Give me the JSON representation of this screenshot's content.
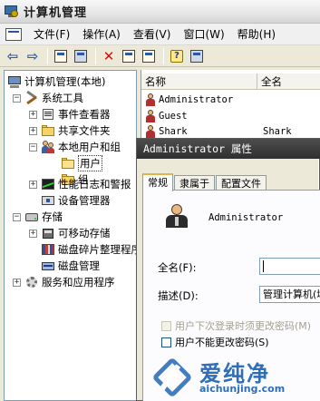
{
  "window": {
    "title": "计算机管理"
  },
  "menu": {
    "items": [
      "文件(F)",
      "操作(A)",
      "查看(V)",
      "窗口(W)",
      "帮助(H)"
    ]
  },
  "tree": {
    "root": "计算机管理(本地)",
    "system_tools": "系统工具",
    "event_viewer": "事件查看器",
    "shared_folders": "共享文件夹",
    "local_users_groups": "本地用户和组",
    "users": "用户",
    "groups": "组",
    "perf_logs": "性能日志和警报",
    "device_manager": "设备管理器",
    "storage": "存储",
    "removable_storage": "可移动存储",
    "disk_defrag": "磁盘碎片整理程序",
    "disk_management": "磁盘管理",
    "services_apps": "服务和应用程序"
  },
  "list": {
    "columns": [
      "名称",
      "全名"
    ],
    "rows": [
      {
        "name": "Administrator",
        "full": ""
      },
      {
        "name": "Guest",
        "full": ""
      },
      {
        "name": "Shark",
        "full": "Shark"
      }
    ]
  },
  "dialog": {
    "title": "Administrator 属性",
    "tabs": [
      "常规",
      "隶属于",
      "配置文件"
    ],
    "username": "Administrator",
    "fullname_label": "全名(F):",
    "fullname_value": "",
    "desc_label": "描述(D):",
    "desc_value": "管理计算机(域)",
    "check_must_change": "用户下次登录时须更改密码(M)",
    "check_cannot_change": "用户不能更改密码(S)"
  },
  "watermark": {
    "brand": "爱纯净",
    "url": "aichunjing.com"
  }
}
